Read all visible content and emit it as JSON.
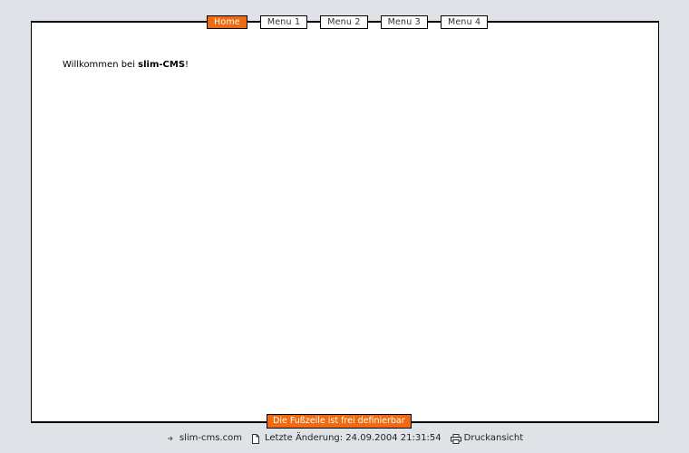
{
  "nav": {
    "items": [
      {
        "label": "Home",
        "active": true
      },
      {
        "label": "Menu 1",
        "active": false
      },
      {
        "label": "Menu 2",
        "active": false
      },
      {
        "label": "Menu 3",
        "active": false
      },
      {
        "label": "Menu 4",
        "active": false
      }
    ]
  },
  "content": {
    "welcome_prefix": "Willkommen bei ",
    "welcome_brand": "slim-CMS",
    "welcome_suffix": "!"
  },
  "footer": {
    "note": "Die Fußzeile ist frei definierbar",
    "site_link": "slim-cms.com",
    "last_change": "Letzte Änderung: 24.09.2004 21:31:54",
    "print_link": "Druckansicht"
  },
  "colors": {
    "accent": "#f06a0f",
    "background": "#dfe2e6"
  },
  "icons": {
    "site": "arrow-right-icon",
    "last_change": "document-icon",
    "print": "printer-icon"
  }
}
